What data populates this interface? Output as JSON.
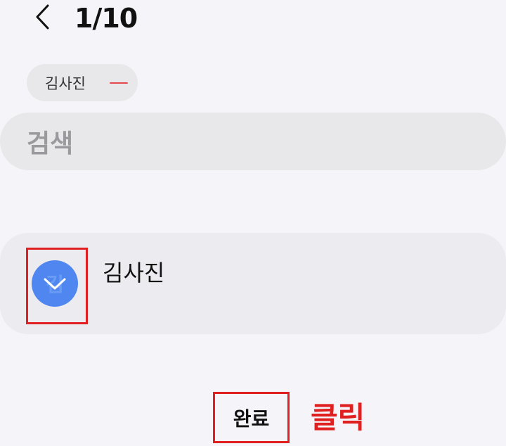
{
  "header": {
    "counter": "1/10",
    "back_icon": "chevron-left-icon"
  },
  "selected_chip": {
    "label": "김사진",
    "remove_icon": "minus-icon"
  },
  "search": {
    "placeholder": "검색"
  },
  "contact": {
    "name": "김사진",
    "avatar_initial": "김",
    "checked": true,
    "check_icon": "check-icon"
  },
  "footer": {
    "done_label": "완료"
  },
  "annotation": {
    "text": "클릭"
  },
  "colors": {
    "background": "#f5f4f8",
    "accent_blue": "#4f86f0",
    "annotation_red": "#e02020",
    "remove_red": "#e5484d"
  }
}
